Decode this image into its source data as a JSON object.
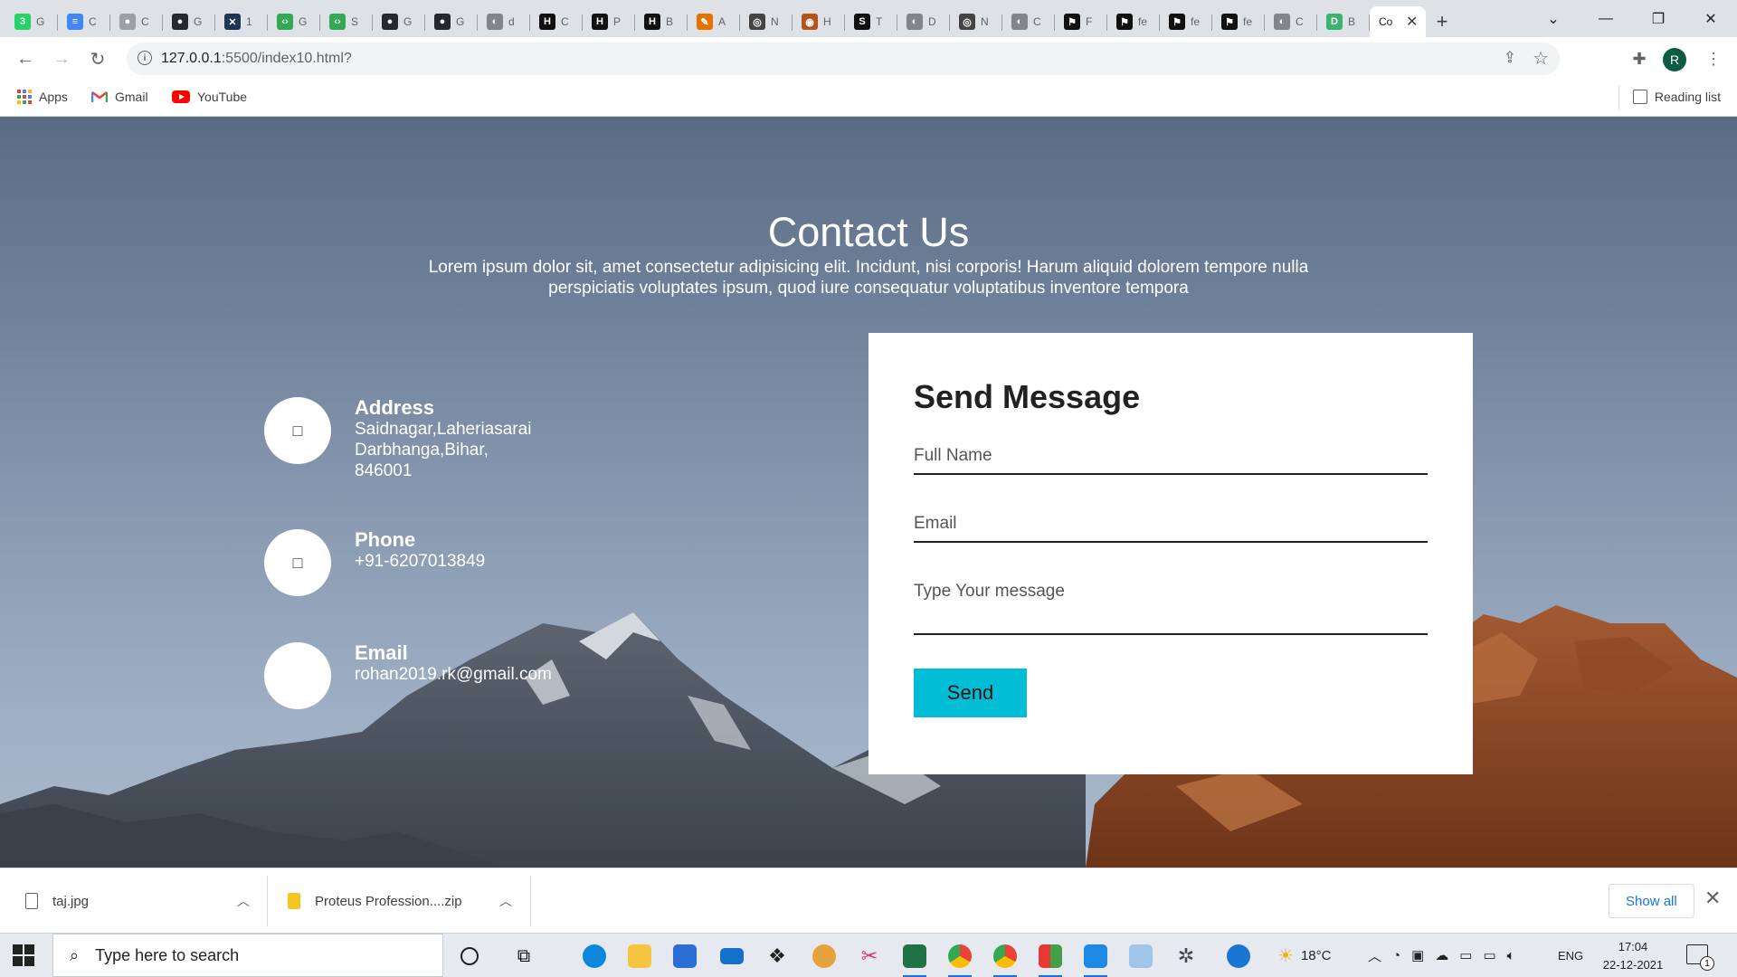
{
  "browser": {
    "tabs": [
      {
        "icon": "whatsapp-icon",
        "color": "#25d366",
        "glyph": "3",
        "title": "G"
      },
      {
        "icon": "docs-icon",
        "color": "#4285f4",
        "glyph": "≡",
        "title": "C"
      },
      {
        "icon": "github-icon",
        "color": "#9aa0a6",
        "glyph": "●",
        "title": "C"
      },
      {
        "icon": "github-icon",
        "color": "#24292e",
        "glyph": "●",
        "title": "G"
      },
      {
        "icon": "x-icon",
        "color": "#1d3557",
        "glyph": "✕",
        "title": "1"
      },
      {
        "icon": "code-icon",
        "color": "#34a853",
        "glyph": "‹›",
        "title": "G"
      },
      {
        "icon": "code-icon",
        "color": "#34a853",
        "glyph": "‹›",
        "title": "S"
      },
      {
        "icon": "github-icon",
        "color": "#24292e",
        "glyph": "●",
        "title": "G"
      },
      {
        "icon": "github-icon",
        "color": "#24292e",
        "glyph": "●",
        "title": "G"
      },
      {
        "icon": "globe-icon",
        "color": "#80868b",
        "glyph": "◐",
        "title": "d"
      },
      {
        "icon": "hackerrank-icon",
        "color": "#111111",
        "glyph": "H",
        "title": "C"
      },
      {
        "icon": "hackerrank-icon",
        "color": "#111111",
        "glyph": "H",
        "title": "P"
      },
      {
        "icon": "hackerrank-icon",
        "color": "#111111",
        "glyph": "H",
        "title": "B"
      },
      {
        "icon": "pen-icon",
        "color": "#e37400",
        "glyph": "✎",
        "title": "A"
      },
      {
        "icon": "globe-icon",
        "color": "#444444",
        "glyph": "◎",
        "title": "N"
      },
      {
        "icon": "owl-icon",
        "color": "#b3541e",
        "glyph": "◉",
        "title": "H"
      },
      {
        "icon": "s-icon",
        "color": "#111111",
        "glyph": "S",
        "title": "T"
      },
      {
        "icon": "globe-icon",
        "color": "#80868b",
        "glyph": "◐",
        "title": "D"
      },
      {
        "icon": "globe-icon",
        "color": "#444444",
        "glyph": "◎",
        "title": "N"
      },
      {
        "icon": "globe-icon",
        "color": "#80868b",
        "glyph": "◐",
        "title": "C"
      },
      {
        "icon": "flag-icon",
        "color": "#111111",
        "glyph": "⚑",
        "title": "F"
      },
      {
        "icon": "flag-icon",
        "color": "#111111",
        "glyph": "⚑",
        "title": "fe"
      },
      {
        "icon": "flag-icon",
        "color": "#111111",
        "glyph": "⚑",
        "title": "fe"
      },
      {
        "icon": "flag-icon",
        "color": "#111111",
        "glyph": "⚑",
        "title": "fe"
      },
      {
        "icon": "globe-icon",
        "color": "#80868b",
        "glyph": "◐",
        "title": "C"
      },
      {
        "icon": "d-icon",
        "color": "#3cb371",
        "glyph": "D",
        "title": "B"
      }
    ],
    "active_tab": {
      "title": "Co",
      "close": "✕"
    },
    "new_tab": "+",
    "window_controls": {
      "list": "⌄",
      "minimize": "—",
      "maximize": "❐",
      "close": "✕"
    },
    "url_host": "127.0.0.1",
    "url_path": ":5500/index10.html?",
    "profile_initial": "R",
    "bookmarks": [
      {
        "label": "Apps"
      },
      {
        "label": "Gmail"
      },
      {
        "label": "YouTube"
      }
    ],
    "reading_list": "Reading list"
  },
  "page": {
    "title": "Contact Us",
    "description": "Lorem ipsum dolor sit, amet consectetur adipisicing elit. Incidunt, nisi corporis! Harum aliquid dolorem tempore nulla perspiciatis voluptates ipsum, quod iure consequatur voluptatibus inventore tempora",
    "contacts": [
      {
        "label": "Address",
        "value": "Saidnagar,Laheriasarai\nDarbhanga,Bihar,\n846001",
        "icon_glyph": "□"
      },
      {
        "label": "Phone",
        "value": "+91-6207013849",
        "icon_glyph": "□"
      },
      {
        "label": "Email",
        "value": "rohan2019.rk@gmail.com",
        "icon_glyph": ""
      }
    ],
    "form": {
      "title": "Send Message",
      "name_placeholder": "Full Name",
      "email_placeholder": "Email",
      "message_placeholder": "Type Your message",
      "submit_label": "Send"
    }
  },
  "downloads": {
    "items": [
      {
        "name": "taj.jpg"
      },
      {
        "name": "Proteus Profession....zip"
      }
    ],
    "show_all": "Show all",
    "close": "✕"
  },
  "taskbar": {
    "search_placeholder": "Type here to search",
    "weather": "18°C",
    "language": "ENG",
    "time": "17:04",
    "date": "22-12-2021",
    "notifications": "1"
  }
}
